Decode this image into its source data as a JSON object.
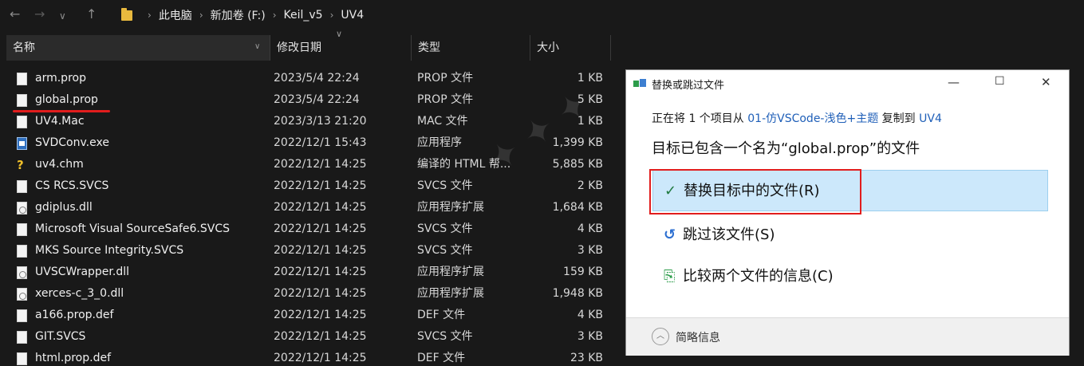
{
  "breadcrumbs": [
    "此电脑",
    "新加卷 (F:)",
    "Keil_v5",
    "UV4"
  ],
  "columns": {
    "name": "名称",
    "date": "修改日期",
    "type": "类型",
    "size": "大小"
  },
  "files": [
    {
      "name": "arm.prop",
      "date": "2023/5/4 22:24",
      "type": "PROP 文件",
      "size": "1 KB",
      "icon": "file-icon"
    },
    {
      "name": "global.prop",
      "date": "2023/5/4 22:24",
      "type": "PROP 文件",
      "size": "5 KB",
      "icon": "file-icon"
    },
    {
      "name": "UV4.Mac",
      "date": "2023/3/13 21:20",
      "type": "MAC 文件",
      "size": "1 KB",
      "icon": "file-icon"
    },
    {
      "name": "SVDConv.exe",
      "date": "2022/12/1 15:43",
      "type": "应用程序",
      "size": "1,399 KB",
      "icon": "exe-icon"
    },
    {
      "name": "uv4.chm",
      "date": "2022/12/1 14:25",
      "type": "编译的 HTML 帮...",
      "size": "5,885 KB",
      "icon": "help-icon"
    },
    {
      "name": "CS RCS.SVCS",
      "date": "2022/12/1 14:25",
      "type": "SVCS 文件",
      "size": "2 KB",
      "icon": "file-icon"
    },
    {
      "name": "gdiplus.dll",
      "date": "2022/12/1 14:25",
      "type": "应用程序扩展",
      "size": "1,684 KB",
      "icon": "dll-icon"
    },
    {
      "name": "Microsoft Visual SourceSafe6.SVCS",
      "date": "2022/12/1 14:25",
      "type": "SVCS 文件",
      "size": "4 KB",
      "icon": "file-icon"
    },
    {
      "name": "MKS Source Integrity.SVCS",
      "date": "2022/12/1 14:25",
      "type": "SVCS 文件",
      "size": "3 KB",
      "icon": "file-icon"
    },
    {
      "name": "UVSCWrapper.dll",
      "date": "2022/12/1 14:25",
      "type": "应用程序扩展",
      "size": "159 KB",
      "icon": "dll-icon"
    },
    {
      "name": "xerces-c_3_0.dll",
      "date": "2022/12/1 14:25",
      "type": "应用程序扩展",
      "size": "1,948 KB",
      "icon": "dll-icon"
    },
    {
      "name": "a166.prop.def",
      "date": "2022/12/1 14:25",
      "type": "DEF 文件",
      "size": "4 KB",
      "icon": "file-icon"
    },
    {
      "name": "GIT.SVCS",
      "date": "2022/12/1 14:25",
      "type": "SVCS 文件",
      "size": "3 KB",
      "icon": "file-icon"
    },
    {
      "name": "html.prop.def",
      "date": "2022/12/1 14:25",
      "type": "DEF 文件",
      "size": "23 KB",
      "icon": "file-icon"
    }
  ],
  "dialog": {
    "title": "替换或跳过文件",
    "sub_prefix": "正在将 1 个项目从",
    "sub_source": "01-仿VSCode-浅色+主题",
    "sub_middle": "复制到",
    "sub_dest": "UV4",
    "heading": "目标已包含一个名为“global.prop”的文件",
    "option_replace": "替换目标中的文件(R)",
    "option_skip": "跳过该文件(S)",
    "option_compare": "比较两个文件的信息(C)",
    "more_info": "简略信息"
  },
  "colors": {
    "accent": "#e11d1d",
    "link": "#1f5fb8",
    "highlight": "#cce8fb"
  }
}
